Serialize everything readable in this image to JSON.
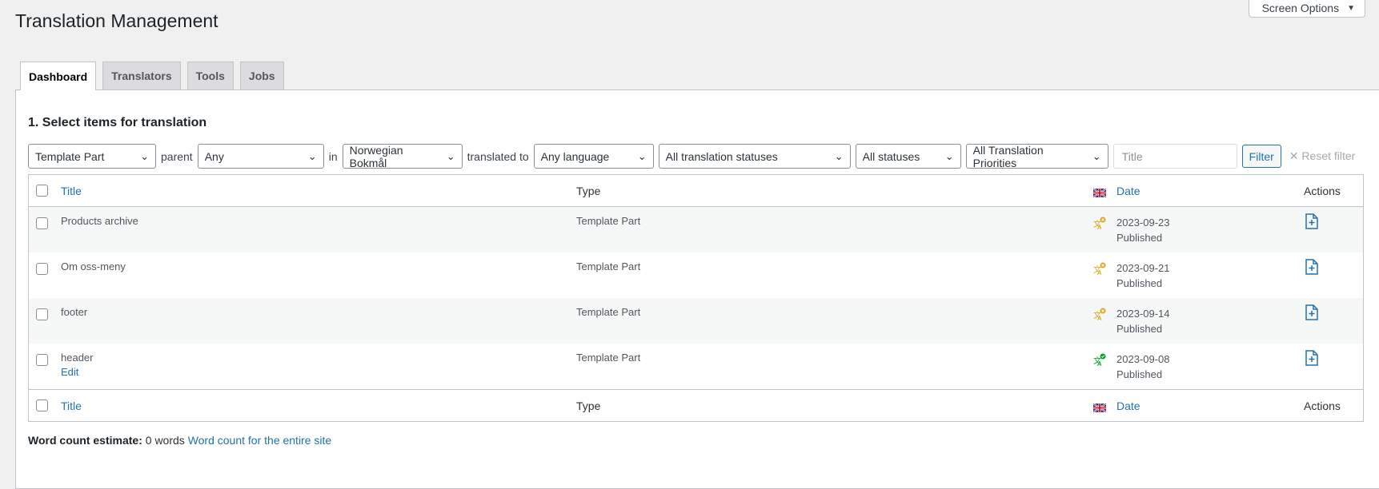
{
  "screen_options": {
    "label": "Screen Options"
  },
  "page": {
    "title": "Translation Management"
  },
  "tabs": [
    {
      "label": "Dashboard",
      "active": true
    },
    {
      "label": "Translators"
    },
    {
      "label": "Tools"
    },
    {
      "label": "Jobs"
    }
  ],
  "section": {
    "title": "1. Select items for translation"
  },
  "filters": {
    "type": "Template Part",
    "parent_label": "parent",
    "parent": "Any",
    "in_label": "in",
    "language": "Norwegian Bokmål",
    "translated_to_label": "translated to",
    "target_language": "Any language",
    "translation_status": "All translation statuses",
    "status": "All statuses",
    "priority": "All Translation Priorities",
    "title_placeholder": "Title",
    "filter_button": "Filter",
    "reset_label": "Reset filter"
  },
  "table": {
    "columns": {
      "title": "Title",
      "type": "Type",
      "date": "Date",
      "actions": "Actions"
    },
    "rows": [
      {
        "title": "Products archive",
        "type": "Template Part",
        "date": "2023-09-23",
        "status": "Published",
        "translation_state": "needs-translation"
      },
      {
        "title": "Om oss-meny",
        "type": "Template Part",
        "date": "2023-09-21",
        "status": "Published",
        "translation_state": "needs-translation"
      },
      {
        "title": "footer",
        "type": "Template Part",
        "date": "2023-09-14",
        "status": "Published",
        "translation_state": "needs-translation"
      },
      {
        "title": "header",
        "type": "Template Part",
        "date": "2023-09-08",
        "status": "Published",
        "translation_state": "complete",
        "row_action": "Edit"
      }
    ]
  },
  "word_count": {
    "label": "Word count estimate:",
    "value": "0 words",
    "link": "Word count for the entire site"
  },
  "colors": {
    "link": "#2271b1",
    "needs_translation": "#dba617",
    "complete": "#00a32a"
  },
  "icons": [
    "caret-down-icon",
    "chevron-down-icon",
    "close-icon",
    "uk-flag-icon",
    "translation-pending-icon",
    "translation-complete-icon",
    "add-translation-icon"
  ]
}
